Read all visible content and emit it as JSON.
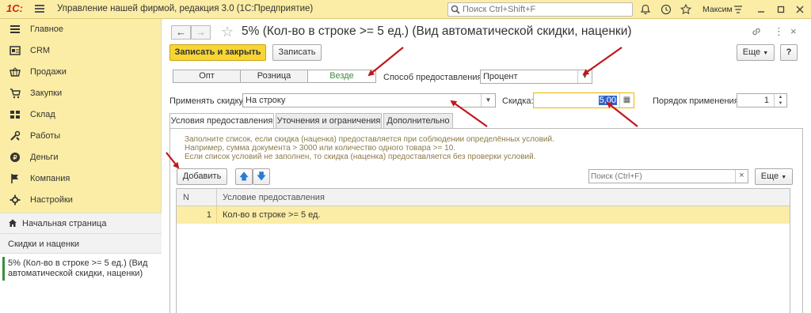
{
  "topbar": {
    "logo": "1С:",
    "app_title": "Управление нашей фирмой, редакция 3.0  (1С:Предприятие)",
    "search_placeholder": "Поиск Ctrl+Shift+F",
    "user": "Максим"
  },
  "sidebar": {
    "items": [
      {
        "label": "Главное",
        "icon": "menu-lines-icon"
      },
      {
        "label": "CRM",
        "icon": "crm-icon"
      },
      {
        "label": "Продажи",
        "icon": "basket-icon"
      },
      {
        "label": "Закупки",
        "icon": "purchase-icon"
      },
      {
        "label": "Склад",
        "icon": "warehouse-icon"
      },
      {
        "label": "Работы",
        "icon": "tools-icon"
      },
      {
        "label": "Деньги",
        "icon": "coin-icon"
      },
      {
        "label": "Компания",
        "icon": "flag-icon"
      },
      {
        "label": "Настройки",
        "icon": "gear-icon"
      }
    ],
    "home": "Начальная страница",
    "section": "Скидки и наценки",
    "open_form": "5% (Кол-во в строке >= 5 ед.) (Вид автоматической скидки, наценки)"
  },
  "form": {
    "title": "5% (Кол-во в строке >= 5 ед.) (Вид автоматической скидки, наценки)",
    "save_close": "Записать и закрыть",
    "save": "Записать",
    "more": "Еще",
    "help": "?",
    "modes": [
      "Опт",
      "Розница",
      "Везде"
    ],
    "active_mode": "Везде",
    "method_label": "Способ предоставления:",
    "method_value": "Процент",
    "apply_label": "Применять скидку:",
    "apply_value": "На строку",
    "discount_label": "Скидка:",
    "discount_value": "5,00",
    "order_label": "Порядок применения:",
    "order_value": "1"
  },
  "tabs": {
    "items": [
      "Условия предоставления",
      "Уточнения и ограничения",
      "Дополнительно"
    ],
    "active": "Условия предоставления"
  },
  "conditions": {
    "hint1": "Заполните список, если скидка (наценка) предоставляется при соблюдении определённых условий.",
    "hint2": "Например, сумма документа > 3000 или количество одного товара >= 10.",
    "hint3": "Если список условий не заполнен, то скидка (наценка) предоставляется без проверки условий.",
    "add_button": "Добавить",
    "search_placeholder": "Поиск (Ctrl+F)",
    "more": "Еще",
    "columns": [
      "N",
      "Условие предоставления"
    ],
    "rows": [
      {
        "n": "1",
        "condition": "Кол-во в строке >= 5 ед."
      }
    ]
  },
  "colors": {
    "accent_yellow": "#fbeda5",
    "primary_button": "#f6d534",
    "annotation_arrow": "#c0161a",
    "active_green": "#3a8f3a"
  }
}
